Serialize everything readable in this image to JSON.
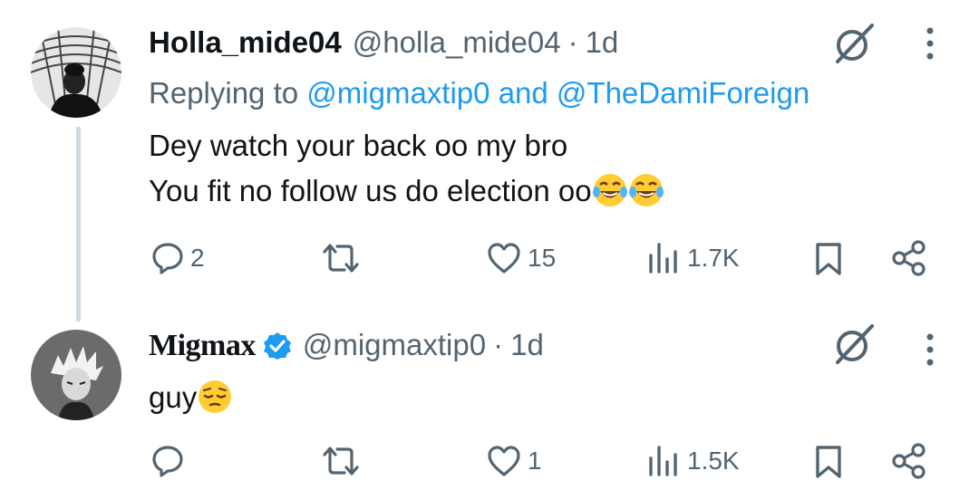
{
  "tweet1": {
    "name": "Holla_mide04",
    "handle": "@holla_mide04",
    "separator": "·",
    "time": "1d",
    "replying_prefix": "Replying to",
    "reply_user1": "@migmaxtip0",
    "reply_and": "and",
    "reply_user2": "@TheDamiForeign",
    "line1": "Dey watch your back oo my bro",
    "line2": "You fit no follow us do election oo",
    "line2_emojis": [
      "laughing-tears-emoji",
      "laughing-tears-emoji"
    ],
    "replies": "2",
    "reposts": "",
    "likes": "15",
    "views": "1.7K"
  },
  "tweet2": {
    "name": "Migmax",
    "verified": true,
    "handle": "@migmaxtip0",
    "separator": "·",
    "time": "1d",
    "text": "guy",
    "text_emoji": "pensive-face-emoji",
    "replies": "",
    "reposts": "",
    "likes": "1",
    "views": "1.5K"
  },
  "colors": {
    "text": "#0f1419",
    "muted": "#536471",
    "link": "#1d9bf0",
    "verified": "#1d9bf0",
    "thread_line": "#cfd9de"
  }
}
